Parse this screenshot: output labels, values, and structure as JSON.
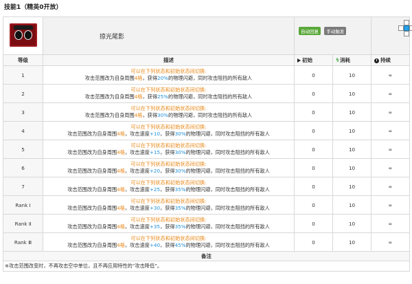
{
  "header": {
    "title": "技能1（精英0开放）"
  },
  "skill": {
    "name": "掠光尾影",
    "tag_auto": "自动回复",
    "tag_manual": "手动触发",
    "icon": "skill-portrait-icon"
  },
  "columns": {
    "level": "等级",
    "desc": "描述",
    "init": "初始",
    "cost": "消耗",
    "dur": "持续"
  },
  "levels": [
    {
      "level": "1",
      "l1": "可以在下列状态和初始状态间切换:",
      "a": "攻击范围改为自身周围",
      "r": "4格",
      "speed": "",
      "mid": "，获得",
      "p": "20%",
      "tail": "的物理闪避，同时攻击阻挡的所有敌人",
      "init": "0",
      "cost": "10",
      "dur": "∞"
    },
    {
      "level": "2",
      "l1": "可以在下列状态和初始状态间切换:",
      "a": "攻击范围改为自身周围",
      "r": "4格",
      "speed": "",
      "mid": "，获得",
      "p": "25%",
      "tail": "的物理闪避，同时攻击阻挡的所有敌人",
      "init": "0",
      "cost": "10",
      "dur": "∞"
    },
    {
      "level": "3",
      "l1": "可以在下列状态和初始状态间切换:",
      "a": "攻击范围改为自身周围",
      "r": "4格",
      "speed": "",
      "mid": "，获得",
      "p": "30%",
      "tail": "的物理闪避，同时攻击阻挡的所有敌人",
      "init": "0",
      "cost": "10",
      "dur": "∞"
    },
    {
      "level": "4",
      "l1": "可以在下列状态和初始状态间切换:",
      "a": "攻击范围改为自身周围",
      "r": "4格",
      "speed": "+10",
      "mid": "，获得",
      "p": "30%",
      "tail": "的物理闪避，同时攻击阻挡的所有敌人",
      "init": "0",
      "cost": "10",
      "dur": "∞"
    },
    {
      "level": "5",
      "l1": "可以在下列状态和初始状态间切换:",
      "a": "攻击范围改为自身周围",
      "r": "4格",
      "speed": "+15",
      "mid": "，获得",
      "p": "30%",
      "tail": "的物理闪避，同时攻击阻挡的所有敌人",
      "init": "0",
      "cost": "10",
      "dur": "∞"
    },
    {
      "level": "6",
      "l1": "可以在下列状态和初始状态间切换:",
      "a": "攻击范围改为自身周围",
      "r": "4格",
      "speed": "+20",
      "mid": "，获得",
      "p": "30%",
      "tail": "的物理闪避，同时攻击阻挡的所有敌人",
      "init": "0",
      "cost": "10",
      "dur": "∞"
    },
    {
      "level": "7",
      "l1": "可以在下列状态和初始状态间切换:",
      "a": "攻击范围改为自身周围",
      "r": "4格",
      "speed": "+25",
      "mid": "，获得",
      "p": "35%",
      "tail": "的物理闪避，同时攻击阻挡的所有敌人",
      "init": "0",
      "cost": "10",
      "dur": "∞"
    },
    {
      "level": "Rank Ⅰ",
      "l1": "可以在下列状态和初始状态间切换:",
      "a": "攻击范围改为自身周围",
      "r": "4格",
      "speed": "+30",
      "mid": "，获得",
      "p": "35%",
      "tail": "的物理闪避，同时攻击阻挡的所有敌人",
      "init": "0",
      "cost": "10",
      "dur": "∞"
    },
    {
      "level": "Rank Ⅱ",
      "l1": "可以在下列状态和初始状态间切换:",
      "a": "攻击范围改为自身周围",
      "r": "4格",
      "speed": "+35",
      "mid": "，获得",
      "p": "35%",
      "tail": "的物理闪避，同时攻击阻挡的所有敌人",
      "init": "0",
      "cost": "10",
      "dur": "∞"
    },
    {
      "level": "Rank Ⅲ",
      "l1": "可以在下列状态和初始状态间切换:",
      "a": "攻击范围改为自身周围",
      "r": "4格",
      "speed": "+40",
      "mid": "，获得",
      "p": "45%",
      "tail": "的物理闪避，同时攻击阻挡的所有敌人",
      "init": "0",
      "cost": "10",
      "dur": "∞"
    }
  ],
  "speed_prefix": "，攻击速度",
  "notes": {
    "title": "备注",
    "text": "※攻击范围改变时，不再攻击空中单位，且不再应用特性的“攻击降低”。"
  }
}
